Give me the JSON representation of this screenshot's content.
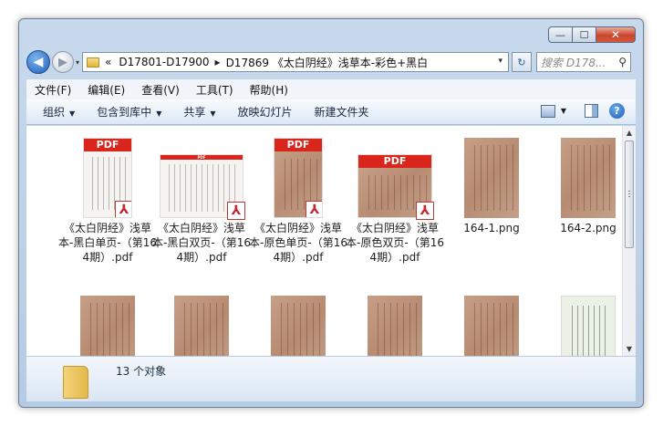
{
  "window": {
    "caption": {
      "minimize": "—",
      "maximize": "☐",
      "close": "✕"
    }
  },
  "nav": {
    "back_icon": "◀",
    "forward_icon": "▶",
    "history_icon": "▾"
  },
  "address": {
    "prefix": "«",
    "crumbs": [
      "D17801-D17900",
      "D17869 《太白阴经》浅草本-彩色+黑白"
    ],
    "separator": "▸",
    "dropdown": "▾",
    "refresh_icon": "↻"
  },
  "search": {
    "placeholder": "搜索 D178...",
    "icon": "⚲"
  },
  "menu": [
    "文件(F)",
    "编辑(E)",
    "查看(V)",
    "工具(T)",
    "帮助(H)"
  ],
  "toolbar": {
    "organize": "组织",
    "include_library": "包含到库中",
    "share": "共享",
    "slideshow": "放映幻灯片",
    "new_folder": "新建文件夹",
    "dropdown_arrow": "▼",
    "help": "?"
  },
  "files": [
    {
      "name": "《太白阴经》浅草本-黑白单页-（第164期）.pdf",
      "type": "pdf",
      "banner": "PDF"
    },
    {
      "name": "《太白阴经》浅草本-黑白双页-（第164期）.pdf",
      "type": "pdf",
      "banner": "PDF"
    },
    {
      "name": "《太白阴经》浅草本-原色单页-（第164期）.pdf",
      "type": "pdf",
      "banner": "PDF"
    },
    {
      "name": "《太白阴经》浅草本-原色双页-（第164期）.pdf",
      "type": "pdf",
      "banner": "PDF"
    },
    {
      "name": "164-1.png",
      "type": "png"
    },
    {
      "name": "164-2.png",
      "type": "png"
    }
  ],
  "acrobat_icon": "⅄",
  "scroll": {
    "up": "▲",
    "down": "▼"
  },
  "status": {
    "count": "13 个对象"
  }
}
